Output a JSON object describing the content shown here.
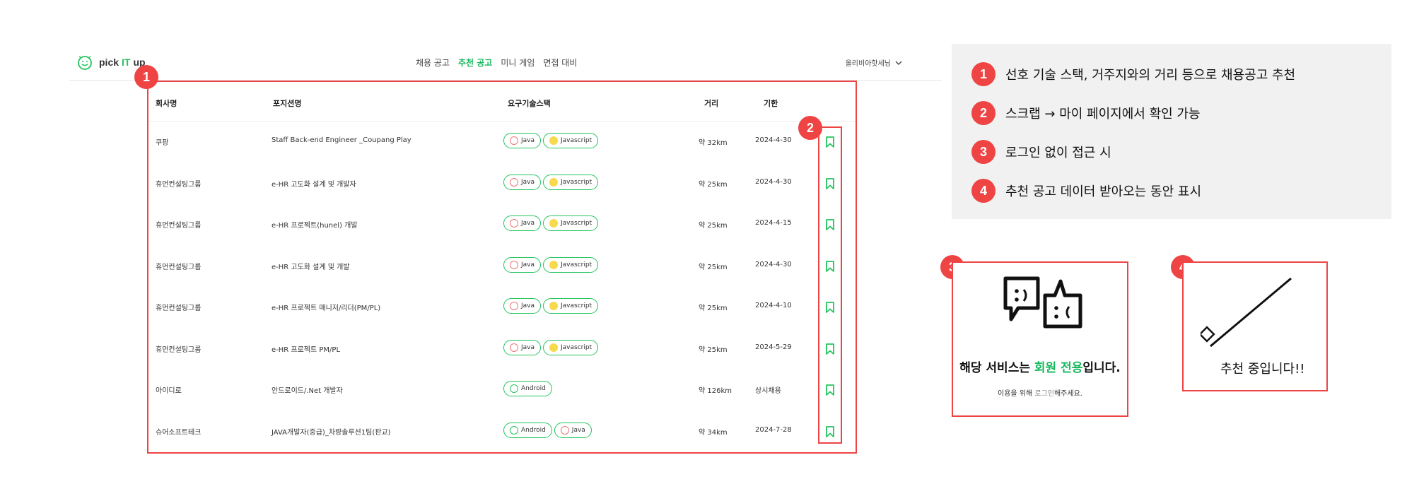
{
  "header": {
    "logo": {
      "pre": "pick",
      "mid": "IT",
      "post": "up"
    },
    "nav": [
      "채용 공고",
      "추천 공고",
      "미니 게임",
      "면접 대비"
    ],
    "active_nav": 1,
    "user": "올리비아핫세님"
  },
  "table": {
    "columns": [
      "회사명",
      "포지션명",
      "요구기술스택",
      "거리",
      "기한"
    ],
    "rows": [
      {
        "company": "쿠팡",
        "position": "Staff Back-end Engineer _Coupang Play",
        "stack": [
          "Java",
          "Javascript"
        ],
        "distance": "약 32km",
        "deadline": "2024-4-30"
      },
      {
        "company": "휴먼컨설팅그룹",
        "position": "e-HR 고도화 설계 및 개발자",
        "stack": [
          "Java",
          "Javascript"
        ],
        "distance": "약 25km",
        "deadline": "2024-4-30"
      },
      {
        "company": "휴먼컨설팅그룹",
        "position": "e-HR 프로젝트(hunel) 개발",
        "stack": [
          "Java",
          "Javascript"
        ],
        "distance": "약 25km",
        "deadline": "2024-4-15"
      },
      {
        "company": "휴먼컨설팅그룹",
        "position": "e-HR 고도화 설계 및 개발",
        "stack": [
          "Java",
          "Javascript"
        ],
        "distance": "약 25km",
        "deadline": "2024-4-30"
      },
      {
        "company": "휴먼컨설팅그룹",
        "position": "e-HR 프로젝트 매니저/리더(PM/PL)",
        "stack": [
          "Java",
          "Javascript"
        ],
        "distance": "약 25km",
        "deadline": "2024-4-10"
      },
      {
        "company": "휴먼컨설팅그룹",
        "position": "e-HR 프로젝트 PM/PL",
        "stack": [
          "Java",
          "Javascript"
        ],
        "distance": "약 25km",
        "deadline": "2024-5-29"
      },
      {
        "company": "아이디로",
        "position": "안드로이드/.Net 개발자",
        "stack": [
          "Android"
        ],
        "distance": "약 126km",
        "deadline": "상시채용"
      },
      {
        "company": "슈어소프트테크",
        "position": "JAVA개발자(중급)_차량솔루션1팀(판교)",
        "stack": [
          "Android",
          "Java"
        ],
        "distance": "약 34km",
        "deadline": "2024-7-28"
      }
    ]
  },
  "badges": [
    "1",
    "2",
    "3",
    "4"
  ],
  "legend": [
    {
      "num": "1",
      "text": "선호 기술 스택, 거주지와의 거리 등으로 채용공고 추천"
    },
    {
      "num": "2",
      "text": "스크랩 → 마이 페이지에서 확인 가능"
    },
    {
      "num": "3",
      "text": "로그인 없이 접근 시"
    },
    {
      "num": "4",
      "text": "추천 공고 데이터 받아오는 동안 표시"
    }
  ],
  "panel3": {
    "title_pre": "해당 서비스는 ",
    "title_green": "회원 전용",
    "title_post": "입니다.",
    "sub_pre": "이용을 위해 ",
    "sub_link": "로그인",
    "sub_post": "해주세요."
  },
  "panel4": {
    "text": "추천 중입니다!!"
  },
  "colors": {
    "accent": "#22c55e",
    "annotation": "#ef4444",
    "legend_bg": "#f1f1f1"
  }
}
